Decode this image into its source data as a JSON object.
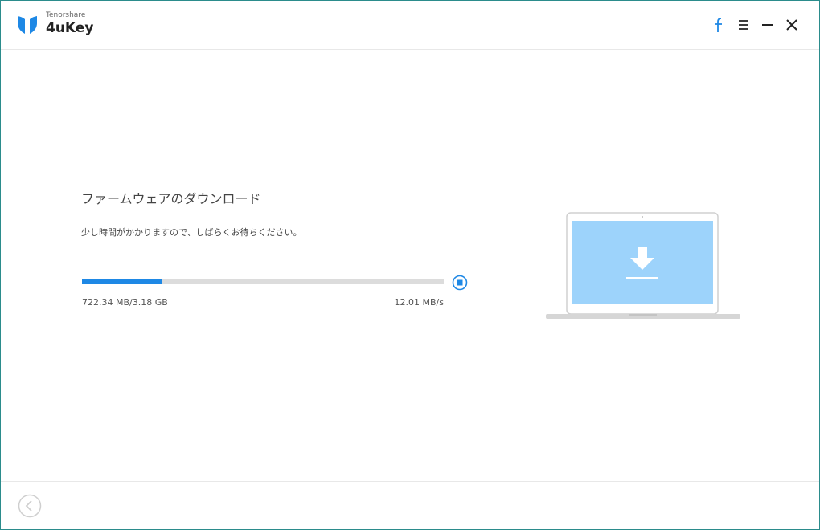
{
  "app": {
    "vendor": "Tenorshare",
    "name": "4uKey"
  },
  "titlebar": {
    "icons": {
      "facebook": "facebook-icon",
      "menu": "menu-icon",
      "minimize": "minimize-icon",
      "close": "close-icon"
    },
    "accent_color": "#1e88e5"
  },
  "download": {
    "title": "ファームウェアのダウンロード",
    "message": "少し時間がかかりますので、しばらくお待ちください。",
    "progress_fraction": 0.222,
    "downloaded_text": "722.34 MB/3.18 GB",
    "speed_text": "12.01 MB/s",
    "stop_icon": "stop-icon"
  },
  "illustration": {
    "icon": "laptop-download-icon",
    "screen_color": "#9dd3fb"
  },
  "footer": {
    "back_icon": "back-arrow-icon"
  }
}
